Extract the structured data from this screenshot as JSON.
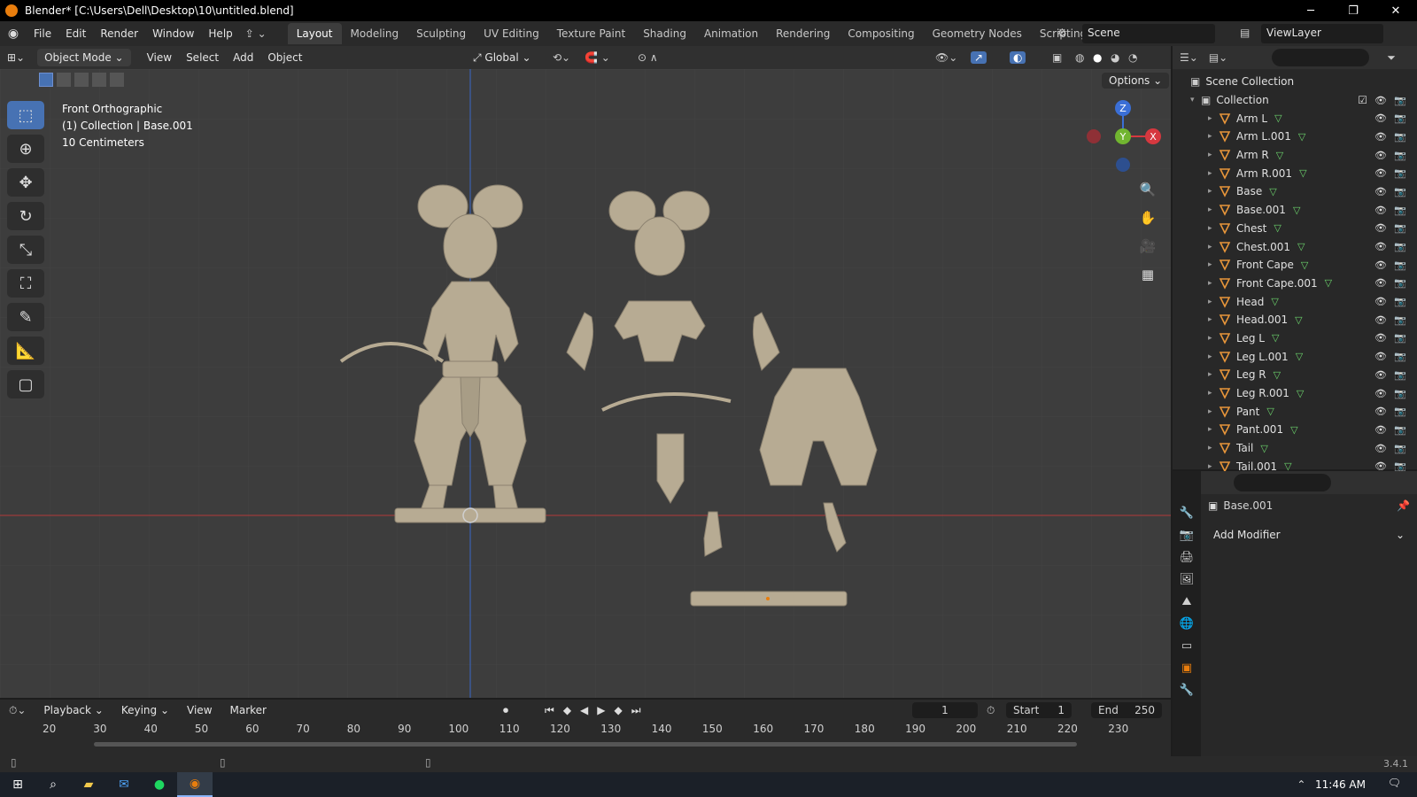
{
  "window": {
    "title": "Blender* [C:\\Users\\Dell\\Desktop\\10\\untitled.blend]"
  },
  "menus": [
    "File",
    "Edit",
    "Render",
    "Window",
    "Help"
  ],
  "workspaces": [
    "Layout",
    "Modeling",
    "Sculpting",
    "UV Editing",
    "Texture Paint",
    "Shading",
    "Animation",
    "Rendering",
    "Compositing",
    "Geometry Nodes",
    "Scripting"
  ],
  "active_workspace": "Layout",
  "scene": "Scene",
  "view_layer": "ViewLayer",
  "viewport_header": {
    "mode": "Object Mode",
    "menus": [
      "View",
      "Select",
      "Add",
      "Object"
    ],
    "transform": "Global",
    "options_label": "Options"
  },
  "viewport_overlay": {
    "view_name": "Front Orthographic",
    "collection_info": "(1) Collection | Base.001",
    "scale": "10 Centimeters"
  },
  "gizmo": {
    "z": "Z",
    "y": "Y",
    "x": "X"
  },
  "outliner": {
    "root": "Scene Collection",
    "collection": "Collection",
    "items": [
      "Arm L",
      "Arm L.001",
      "Arm R",
      "Arm R.001",
      "Base",
      "Base.001",
      "Chest",
      "Chest.001",
      "Front Cape",
      "Front Cape.001",
      "Head",
      "Head.001",
      "Leg L",
      "Leg L.001",
      "Leg R",
      "Leg R.001",
      "Pant",
      "Pant.001",
      "Tail",
      "Tail.001"
    ]
  },
  "properties": {
    "object_name": "Base.001",
    "add_modifier": "Add Modifier"
  },
  "timeline": {
    "menus": [
      "Playback",
      "Keying",
      "View",
      "Marker"
    ],
    "current_frame": "1",
    "start_label": "Start",
    "start_value": "1",
    "end_label": "End",
    "end_value": "250",
    "ruler": [
      "20",
      "30",
      "40",
      "50",
      "60",
      "70",
      "80",
      "90",
      "100",
      "110",
      "120",
      "130",
      "140",
      "150",
      "160",
      "170",
      "180",
      "190",
      "200",
      "210",
      "220",
      "230"
    ]
  },
  "status": {
    "version": "3.4.1"
  },
  "taskbar": {
    "time": "11:46 AM"
  },
  "colors": {
    "accent": "#4772b3",
    "brand": "#e87d0d",
    "mesh_icon": "#e8963a"
  }
}
